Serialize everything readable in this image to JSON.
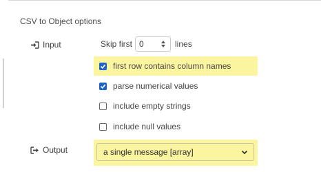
{
  "section": {
    "title": "CSV to Object options"
  },
  "input": {
    "label": "Input",
    "icon": "sign-in-icon",
    "skip_prefix": "Skip first",
    "skip_value": "0",
    "skip_suffix": "lines"
  },
  "options": [
    {
      "label": "first row contains column names",
      "checked": true,
      "highlighted": true
    },
    {
      "label": "parse numerical values",
      "checked": true,
      "highlighted": false
    },
    {
      "label": "include empty strings",
      "checked": false,
      "highlighted": false
    },
    {
      "label": "include null values",
      "checked": false,
      "highlighted": false
    }
  ],
  "output": {
    "label": "Output",
    "icon": "sign-out-icon",
    "selected": "a single message [array]",
    "highlighted": true
  },
  "colors": {
    "highlight": "#fbf5a0",
    "checkbox_checked": "#1d64c8",
    "text": "#444444"
  }
}
